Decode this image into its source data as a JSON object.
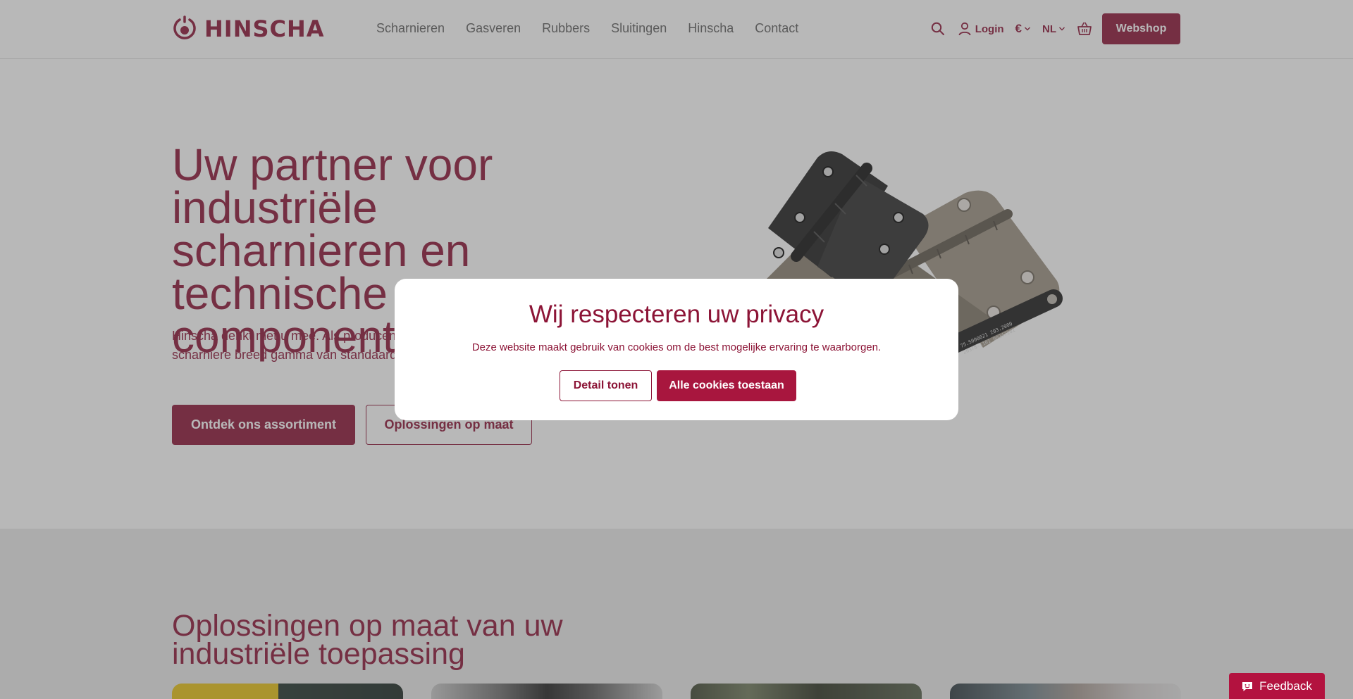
{
  "brand": {
    "name": "HINSCHA",
    "color": "#8c1436"
  },
  "nav": {
    "items": [
      "Scharnieren",
      "Gasveren",
      "Rubbers",
      "Sluitingen",
      "Hinscha",
      "Contact"
    ]
  },
  "header": {
    "search_icon": "search-icon",
    "login_label": "Login",
    "currency": "€",
    "language": "NL",
    "cart_icon": "basket-icon",
    "webshop_label": "Webshop"
  },
  "hero": {
    "title": "Uw partner voor industriële scharnieren en technische componenten",
    "text": "Hinscha denkt met u mee. Als producent de markt van zowel industriële scharniere breed gamma van standaard artikelen bie",
    "primary_button": "Ontdek ons assortiment",
    "secondary_button": "Oplossingen op maat",
    "stamp_line1": "75.5000021 203.2000",
    "stamp_line2": "20378-1101 00247201"
  },
  "section2": {
    "title": "Oplossingen op maat van uw industriële toepassing"
  },
  "cookie_modal": {
    "title": "Wij respecteren uw privacy",
    "text": "Deze website maakt gebruik van cookies om de best mogelijke ervaring te waarborgen.",
    "detail_button": "Detail tonen",
    "allow_button": "Alle cookies toestaan"
  },
  "feedback": {
    "label": "Feedback",
    "icon": "feedback-icon"
  }
}
